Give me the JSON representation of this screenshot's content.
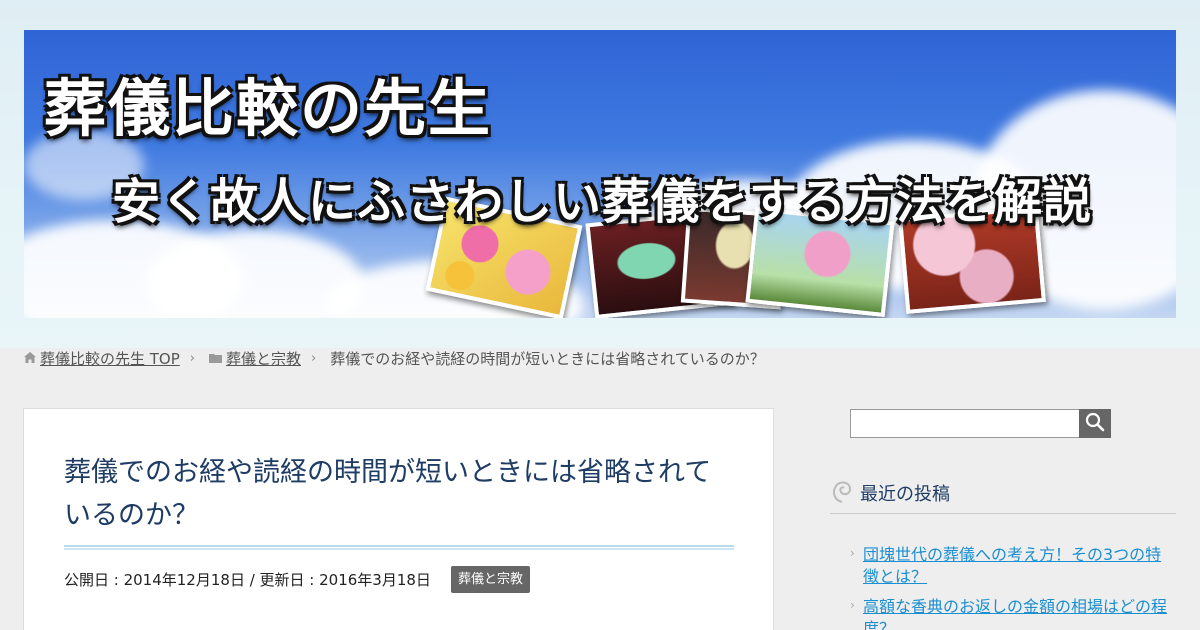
{
  "header": {
    "title": "葬儀比較の先生",
    "subtitle": "安く故人にふさわしい葬儀をする方法を解説",
    "photos": [
      "chrysanthemum-photo",
      "lantern-photo",
      "lantern-photo",
      "lotus-photo",
      "cherry-blossom-temple-photo"
    ]
  },
  "breadcrumb": {
    "home_label": "葬儀比較の先生 TOP",
    "category_label": "葬儀と宗教",
    "current_label": "葬儀でのお経や読経の時間が短いときには省略されているのか？",
    "separator": "›"
  },
  "article": {
    "title": "葬儀でのお経や読経の時間が短いときには省略されているのか？",
    "meta": "公開日 : 2014年12月18日 / 更新日 : 2016年3月18日",
    "category": "葬儀と宗教"
  },
  "sidebar": {
    "search": {
      "placeholder": "",
      "value": ""
    },
    "recent_heading": "最近の投稿",
    "recent_posts": [
      {
        "title": "団塊世代の葬儀への考え方！その3つの特徴とは？"
      },
      {
        "title": "高額な香典のお返しの金額の相場はどの程度？"
      }
    ]
  },
  "colors": {
    "accent_title": "#1e3c64",
    "link": "#1c8fd0",
    "badge_bg": "#666666"
  }
}
